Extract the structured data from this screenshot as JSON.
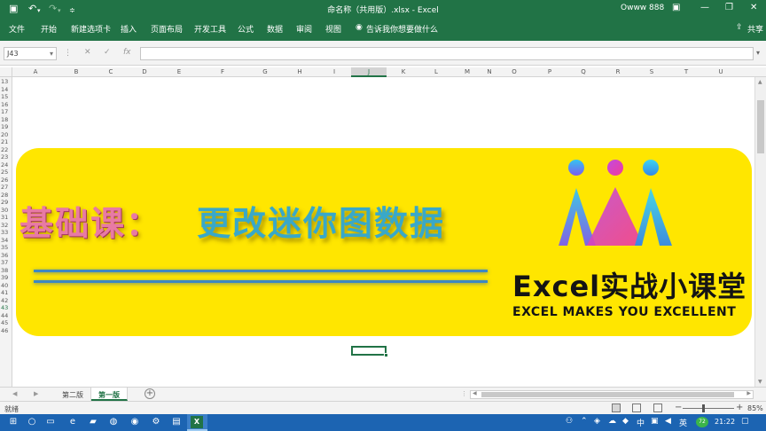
{
  "window": {
    "title": "命名称（共用版）.xlsx - Excel",
    "user": "Owww 888"
  },
  "ribbon": {
    "tabs": [
      "文件",
      "开始",
      "新建选项卡",
      "插入",
      "页面布局",
      "开发工具",
      "公式",
      "数据",
      "审阅",
      "视图"
    ],
    "tell_me": "告诉我你想要做什么",
    "share": "共享"
  },
  "formula_bar": {
    "name_box": "J43",
    "fx": "fx"
  },
  "columns": [
    "A",
    "B",
    "C",
    "D",
    "E",
    "F",
    "G",
    "H",
    "I",
    "J",
    "K",
    "L",
    "M",
    "N",
    "O",
    "P",
    "Q",
    "R",
    "S",
    "T",
    "U"
  ],
  "active_column": "J",
  "rows": [
    "13",
    "14",
    "15",
    "16",
    "17",
    "18",
    "19",
    "20",
    "21",
    "22",
    "23",
    "24",
    "25",
    "26",
    "27",
    "28",
    "29",
    "30",
    "31",
    "32",
    "33",
    "34",
    "35",
    "36",
    "37",
    "38",
    "39",
    "40",
    "41",
    "42",
    "43",
    "44",
    "45",
    "46"
  ],
  "active_row": "43",
  "banner": {
    "title_left": "基础课：",
    "title_right": "更改迷你图数据",
    "brand": "Excel实战小课堂",
    "tagline": "EXCEL MAKES YOU EXCELLENT",
    "background_color": "#ffe600"
  },
  "sheets": {
    "tabs": [
      "第二版",
      "第一版"
    ],
    "active": "第一版"
  },
  "status": {
    "text": "就绪",
    "zoom": "85%"
  },
  "taskbar": {
    "time": "21:22",
    "badge": "72"
  },
  "colors": {
    "excel_green": "#217346",
    "taskbar_blue": "#1c64b2"
  }
}
